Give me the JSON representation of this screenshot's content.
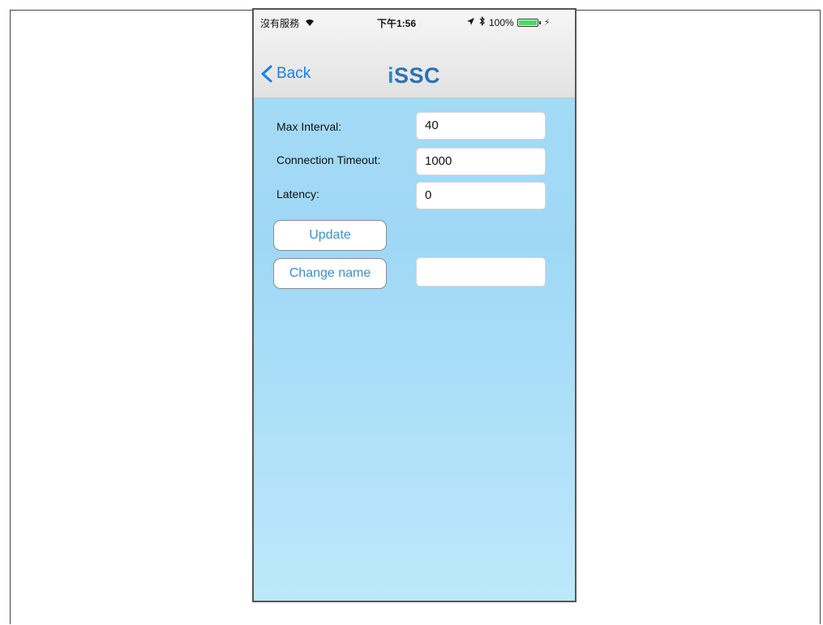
{
  "status_bar": {
    "carrier": "沒有服務",
    "time": "下午1:56",
    "battery": "100%",
    "battery_level": 1.0
  },
  "nav": {
    "back_label": "Back",
    "logo_text": "iSSC"
  },
  "form": {
    "max_interval": {
      "label": "Max Interval:",
      "value": "40"
    },
    "connection_timeout": {
      "label": "Connection Timeout:",
      "value": "1000"
    },
    "latency": {
      "label": "Latency:",
      "value": "0"
    },
    "name": {
      "value": ""
    }
  },
  "buttons": {
    "update": "Update",
    "change_name": "Change name"
  },
  "colors": {
    "accent": "#1a7ee8",
    "button_text": "#3b8fd0",
    "logo": "#2a6fb5",
    "background": "#a6dcf6"
  },
  "icons": [
    "wifi-icon",
    "location-icon",
    "bluetooth-icon",
    "battery-icon",
    "back-chevron-icon"
  ]
}
